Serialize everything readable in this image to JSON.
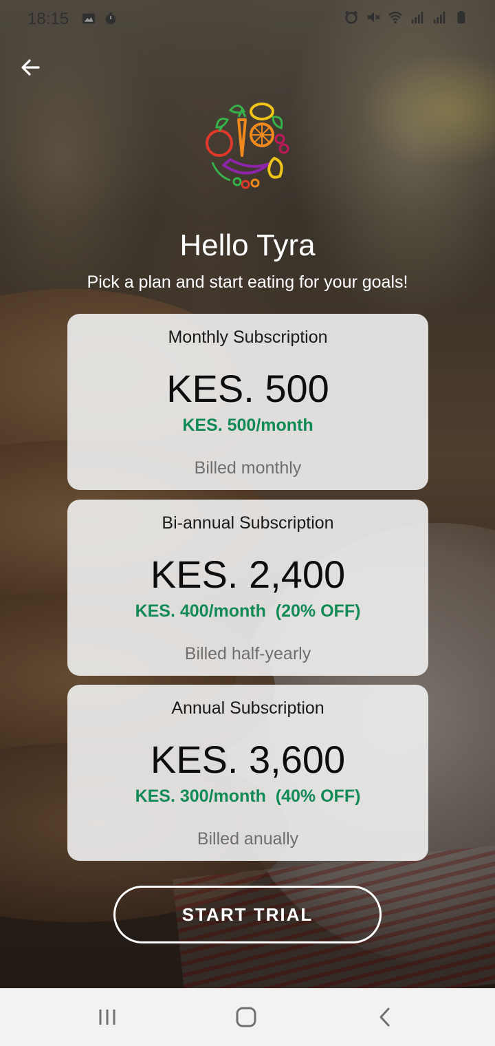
{
  "status_bar": {
    "time": "18:15",
    "left_icons": [
      "image-icon",
      "timer-icon"
    ],
    "right_icons": [
      "alarm-icon",
      "mute-icon",
      "wifi-icon",
      "signal-icon",
      "signal-icon",
      "battery-icon"
    ]
  },
  "header": {
    "back_icon": "arrow-left-icon",
    "logo": "vegetables-wreath-logo",
    "greeting": "Hello Tyra",
    "subtitle": "Pick a plan and start eating for your goals!"
  },
  "plans": [
    {
      "name": "Monthly Subscription",
      "price": "KES. 500",
      "rate": "KES. 500/month",
      "billing": "Billed monthly"
    },
    {
      "name": "Bi-annual Subscription",
      "price": "KES. 2,400",
      "rate": "KES. 400/month  (20% OFF)",
      "billing": "Billed half-yearly"
    },
    {
      "name": "Annual Subscription",
      "price": "KES. 3,600",
      "rate": "KES. 300/month  (40% OFF)",
      "billing": "Billed anually"
    }
  ],
  "cta": {
    "label": "START TRIAL"
  },
  "nav_bar": {
    "icons": [
      "recents-icon",
      "home-icon",
      "back-icon"
    ]
  },
  "colors": {
    "accent_green": "#118a55",
    "card_background": "#f0f0f0",
    "text_white": "#ffffff"
  }
}
